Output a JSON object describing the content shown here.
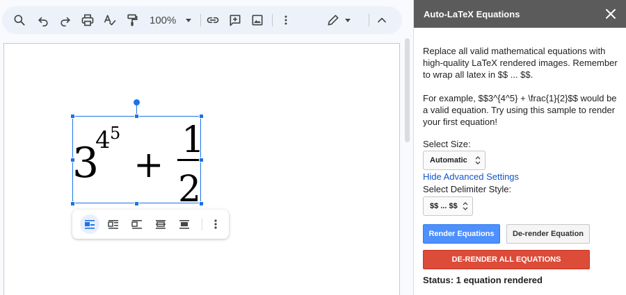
{
  "toolbar": {
    "zoom": "100%",
    "icons": [
      "search-icon",
      "undo-icon",
      "redo-icon",
      "print-icon",
      "spellcheck-icon",
      "paint-format-icon",
      "link-icon",
      "add-comment-icon",
      "insert-image-icon",
      "more-vert-icon",
      "pencil-edit-icon",
      "collapse-icon"
    ]
  },
  "image_toolbar": {
    "icons": [
      "inline-icon",
      "wrap-text-icon",
      "break-text-icon",
      "behind-text-icon",
      "in-front-of-text-icon",
      "more-options-icon"
    ]
  },
  "sidebar": {
    "title": "Auto-LaTeX Equations",
    "intro": "Replace all valid mathematical equations with high-quality LaTeX rendered images. Remember to wrap all latex in $$ ... $$.",
    "example": "For example, $$3^{4^5} + \\frac{1}{2}$$ would be a valid equation. Try using this sample to render your first equation!",
    "size_label": "Select Size:",
    "size_value": "Automatic",
    "advanced_link": "Hide Advanced Settings",
    "delimiter_label": "Select Delimiter Style:",
    "delimiter_value": "$$ ... $$",
    "render_button": "Render Equations",
    "derender_button": "De-render Equation",
    "derender_all_button": "DE-RENDER ALL EQUATIONS",
    "status": "Status: 1 equation rendered"
  },
  "colors": {
    "selection": "#1a73e8",
    "header": "#5b5b5b",
    "primary": "#4d90fe",
    "danger": "#dd4b39",
    "link": "#1155cc"
  }
}
